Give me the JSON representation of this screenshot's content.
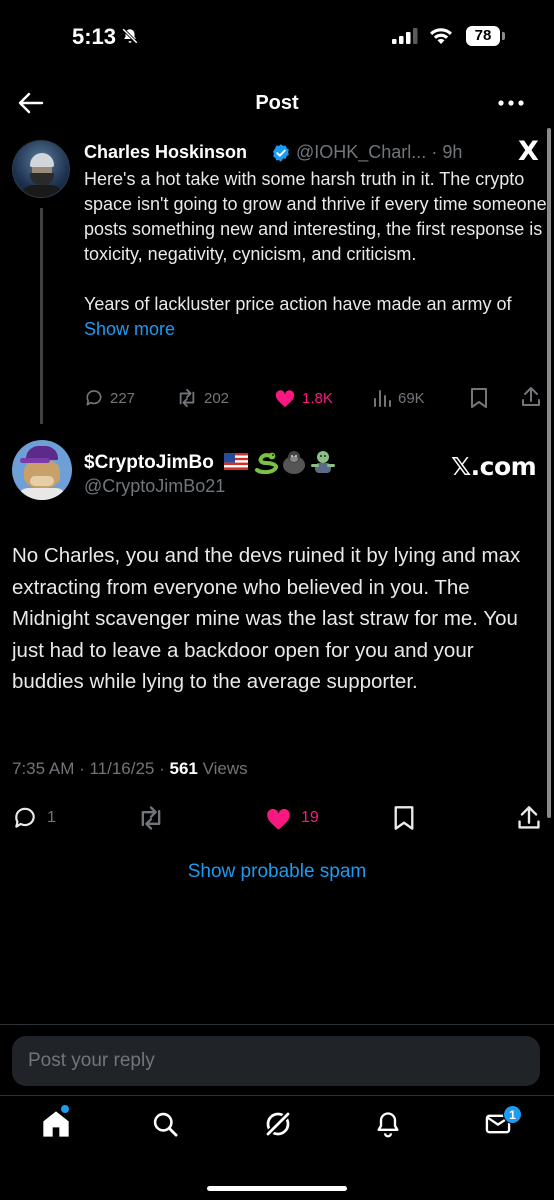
{
  "status_bar": {
    "time": "5:13",
    "battery": "78",
    "icons": [
      "bell-slash-icon",
      "signal-icon",
      "wifi-icon",
      "battery-icon"
    ]
  },
  "header": {
    "title": "Post",
    "back_icon": "arrow-left-icon",
    "more_icon": "more-horizontal-icon"
  },
  "quoted_post": {
    "author_name": "Charles Hoskinson",
    "handle": "@IOHK_Charl...",
    "age": "· 9h",
    "logo_text": "X",
    "body_1": "Here's a hot take with some harsh truth in it. The crypto space isn't going to grow and thrive if every time someone posts something new and interesting, the first response is toxicity, negativity, cynicism, and criticism.",
    "body_2": "Years of lackluster price action have made an army of",
    "show_more": "Show more",
    "actions": {
      "replies": "227",
      "reposts": "202",
      "likes": "1.8K",
      "views": "69K"
    }
  },
  "main_post": {
    "author_name": "$CryptoJimBo",
    "emojis": [
      "us-flag-icon",
      "snake-icon",
      "gorilla-icon",
      "zombie-icon"
    ],
    "handle": "@CryptoJimBo21",
    "watermark": "𝕏.com",
    "body": "No Charles, you and the devs ruined it by lying and max extracting from everyone who believed in you. The Midnight scavenger mine was the last straw for me. You just had to leave a backdoor open for you and your buddies while lying to the average supporter.",
    "timestamp": "7:35 AM · 11/16/25 · ",
    "views_count": "561",
    "views_label": " Views",
    "actions": {
      "replies": "1",
      "likes": "19"
    }
  },
  "show_spam": "Show probable spam",
  "reply": {
    "placeholder": "Post your reply"
  },
  "bottom_nav": {
    "items": [
      "home-icon",
      "search-icon",
      "grok-icon",
      "notifications-icon",
      "messages-icon"
    ],
    "messages_badge": "1"
  },
  "colors": {
    "background": "#000000",
    "accent": "#1d9bf0",
    "like": "#f91880",
    "muted": "#71767b",
    "text": "#e7e9ea"
  }
}
